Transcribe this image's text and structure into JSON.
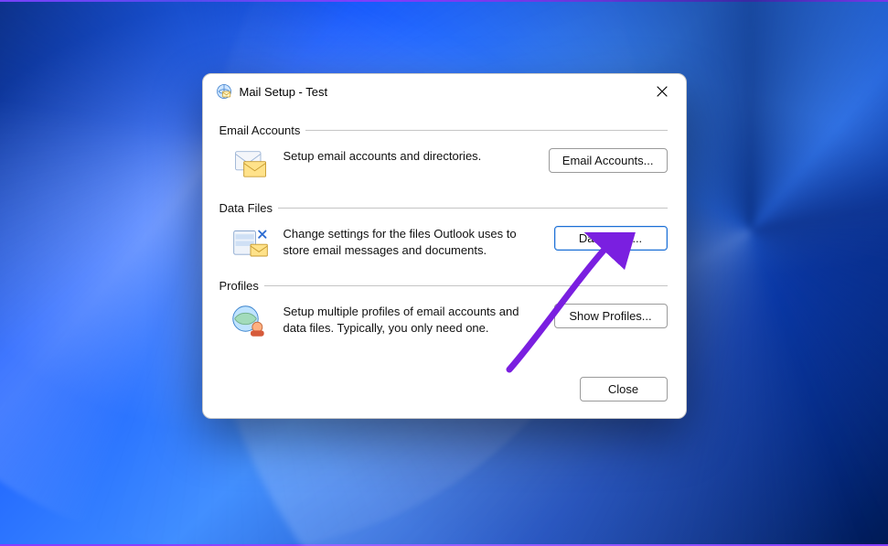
{
  "titlebar": {
    "title": "Mail Setup - Test"
  },
  "sections": {
    "email_accounts": {
      "legend": "Email Accounts",
      "description": "Setup email accounts and directories.",
      "button_label": "Email Accounts..."
    },
    "data_files": {
      "legend": "Data Files",
      "description": "Change settings for the files Outlook uses to store email messages and documents.",
      "button_label": "Data Files..."
    },
    "profiles": {
      "legend": "Profiles",
      "description": "Setup multiple profiles of email accounts and data files. Typically, you only need one.",
      "button_label": "Show Profiles..."
    }
  },
  "footer": {
    "close_label": "Close"
  },
  "annotation": {
    "arrow_color": "#7a1fe0"
  }
}
